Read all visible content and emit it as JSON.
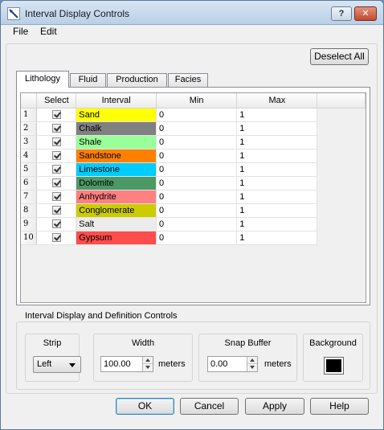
{
  "window": {
    "title": "Interval Display Controls",
    "help_glyph": "?",
    "close_glyph": "✕"
  },
  "menu": {
    "file": "File",
    "edit": "Edit"
  },
  "toolbar": {
    "deselect_all": "Deselect All"
  },
  "tabs": [
    {
      "label": "Lithology",
      "active": true
    },
    {
      "label": "Fluid",
      "active": false
    },
    {
      "label": "Production",
      "active": false
    },
    {
      "label": "Facies",
      "active": false
    }
  ],
  "table": {
    "headers": {
      "select": "Select",
      "interval": "Interval",
      "min": "Min",
      "max": "Max"
    },
    "rows": [
      {
        "num": "1",
        "selected": true,
        "interval": "Sand",
        "color": "#ffff00",
        "min": "0",
        "max": "1"
      },
      {
        "num": "2",
        "selected": true,
        "interval": "Chalk",
        "color": "#808080",
        "min": "0",
        "max": "1"
      },
      {
        "num": "3",
        "selected": true,
        "interval": "Shale",
        "color": "#99ff99",
        "min": "0",
        "max": "1"
      },
      {
        "num": "4",
        "selected": true,
        "interval": "Sandstone",
        "color": "#ff8000",
        "min": "0",
        "max": "1"
      },
      {
        "num": "5",
        "selected": true,
        "interval": "Limestone",
        "color": "#00ccff",
        "min": "0",
        "max": "1"
      },
      {
        "num": "6",
        "selected": true,
        "interval": "Dolomite",
        "color": "#4c9966",
        "min": "0",
        "max": "1"
      },
      {
        "num": "7",
        "selected": true,
        "interval": "Anhydrite",
        "color": "#ff8080",
        "min": "0",
        "max": "1"
      },
      {
        "num": "8",
        "selected": true,
        "interval": "Conglomerate",
        "color": "#cccc00",
        "min": "0",
        "max": "1"
      },
      {
        "num": "9",
        "selected": true,
        "interval": "Salt",
        "color": "#ececec",
        "min": "0",
        "max": "1"
      },
      {
        "num": "10",
        "selected": true,
        "interval": "Gypsum",
        "color": "#ff4c4c",
        "min": "0",
        "max": "1"
      }
    ]
  },
  "controls": {
    "section_title": "Interval Display and Definition Controls",
    "strip": {
      "label": "Strip",
      "value": "Left"
    },
    "width": {
      "label": "Width",
      "value": "100.00",
      "unit": "meters"
    },
    "snap_buffer": {
      "label": "Snap Buffer",
      "value": "0.00",
      "unit": "meters"
    },
    "background": {
      "label": "Background",
      "color": "#000000"
    }
  },
  "buttons": {
    "ok": "OK",
    "cancel": "Cancel",
    "apply": "Apply",
    "help": "Help"
  }
}
